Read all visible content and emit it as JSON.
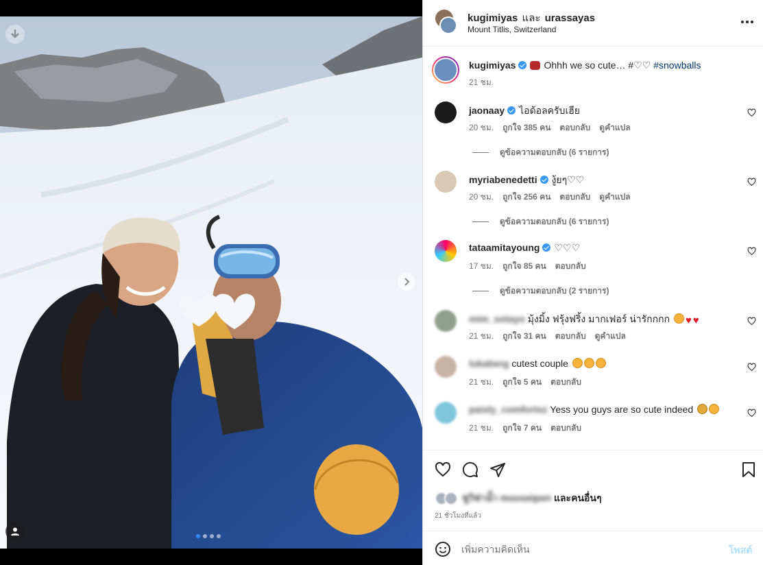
{
  "colors": {
    "accent": "#0095f6",
    "verified": "#3897f0",
    "muted": "#737373",
    "text": "#262626"
  },
  "media": {
    "icons": {
      "download": "download-arrow-icon",
      "next": "chevron-right-icon",
      "tag": "user-tag-icon"
    },
    "carousel_dots": 4,
    "active_dot": 0
  },
  "header": {
    "user1": "kugimiyas",
    "and": "และ",
    "user2": "urassayas",
    "location": "Mount Titlis, Switzerland",
    "more_icon": "more-horizontal-icon"
  },
  "caption": {
    "user": "kugimiyas",
    "text": "Ohhh we so cute… #♡♡",
    "hashtag": "#snowballs",
    "time": "21 ชม."
  },
  "comments": [
    {
      "user": "jaonaay",
      "verified": true,
      "text": "ไอด้อลครับเฮีย",
      "time": "20 ชม.",
      "likes": "ถูกใจ 385 คน",
      "reply": "ตอบกลับ",
      "translate": "ดูคำแปล",
      "replies": "ดูข้อความตอบกลับ (6 รายการ)"
    },
    {
      "user": "myriabenedetti",
      "verified": true,
      "text": "งู้ยๆ♡♡",
      "time": "20 ชม.",
      "likes": "ถูกใจ 256 คน",
      "reply": "ตอบกลับ",
      "translate": "ดูคำแปล",
      "replies": "ดูข้อความตอบกลับ (6 รายการ)"
    },
    {
      "user": "tataamitayoung",
      "verified": true,
      "text": "♡♡♡",
      "time": "17 ชม.",
      "likes": "ถูกใจ 85 คน",
      "reply": "ตอบกลับ",
      "replies": "ดูข้อความตอบกลับ (2 รายการ)"
    },
    {
      "user": "mim_sotayo",
      "blurred": true,
      "text": "มุ้งมิ้ง ฟรุ้งฟริ้ง มากเฟอร์ น่ารักกกก",
      "time": "21 ชม.",
      "likes": "ถูกใจ 31 คน",
      "reply": "ตอบกลับ",
      "translate": "ดูคำแปล"
    },
    {
      "user": "lukaberg",
      "blurred": true,
      "text": "cutest couple",
      "time": "21 ชม.",
      "likes": "ถูกใจ 5 คน",
      "reply": "ตอบกลับ"
    },
    {
      "user": "paisly_comfortsz",
      "blurred": true,
      "text": "Yess you guys are so cute indeed",
      "time": "21 ชม.",
      "likes": "ถูกใจ 7 คน",
      "reply": "ตอบกลับ"
    }
  ],
  "actions": {
    "like_icon": "heart-icon",
    "comment_icon": "comment-icon",
    "share_icon": "send-icon",
    "save_icon": "bookmark-icon",
    "liked_by_blurred": "ชูวิช่าน้ำ mooseipen",
    "liked_by_tail": "และคนอื่นๆ",
    "time": "21 ชั่วโมงที่แล้ว"
  },
  "add_comment": {
    "placeholder": "เพิ่มความคิดเห็น",
    "post_label": "โพสต์",
    "emoji_icon": "smiley-icon"
  }
}
